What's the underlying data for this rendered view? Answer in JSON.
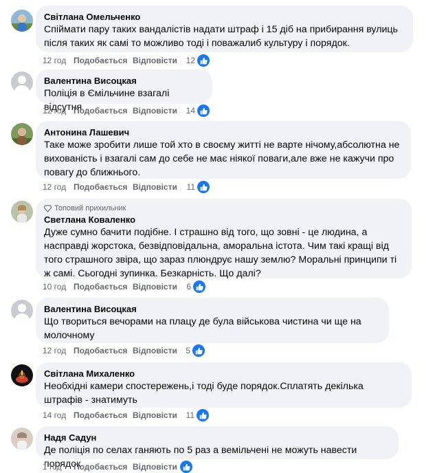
{
  "colors": {
    "bubble_bg": "#f0f2f5",
    "meta_text": "#65676b",
    "like_blue": "#1877f2",
    "text": "#050505"
  },
  "comments": [
    {
      "author": "Світлана Омельченко",
      "badge": "",
      "text": "Спіймати пару таких вандалістів надати штраф і 15 діб на прибирання вулиць після таких як самі то можливо тоді і поважалиб культуру і порядок.",
      "time": "12 год",
      "like_label": "Подобається",
      "reply_label": "Відповісти",
      "reactions": "12",
      "reaction_icon": "thumbs-up-icon",
      "avatar_icon": "profile-photo-icon"
    },
    {
      "author": "Валентина Висоцкая",
      "badge": "",
      "text": "Поліція в Ємільчине взагалі відсутня",
      "time": "12 год",
      "like_label": "Подобається",
      "reply_label": "Відповісти",
      "reactions": "14",
      "reaction_icon": "thumbs-up-icon",
      "avatar_icon": "default-avatar-icon"
    },
    {
      "author": "Антонина Лашевич",
      "badge": "",
      "text": "Таке може зробити лише той хто в своєму житті не варте нічому,абсолютна не вихованість і взагалі сам до себе не має ніякої поваги,але вже не кажучи про повагу до ближнього.",
      "time": "12 год",
      "like_label": "Подобається",
      "reply_label": "Відповісти",
      "reactions": "11",
      "reaction_icon": "thumbs-up-icon",
      "avatar_icon": "profile-photo-icon"
    },
    {
      "author": "Светлана Коваленко",
      "badge": "Топовий прихильник",
      "text": "Дуже сумно бачити подібне. І страшно від того, що зовні - це людина, а насправді жорстока, безвідповідальна, аморальна істота. Чим такі кращі від того страшного звіра, що зараз плюндрує нашу землю? Моральні принципи ті ж самі. Сьогодні зупинка. Безкарність. Що далі?",
      "time": "10 год",
      "like_label": "Подобається",
      "reply_label": "Відповісти",
      "reactions": "6",
      "reaction_icon": "thumbs-up-icon",
      "avatar_icon": "profile-photo-icon"
    },
    {
      "author": "Валентина Висоцкая",
      "badge": "",
      "text": "Що твориться вечорами на плацу де була військова чистина чи ще на молочному",
      "time": "12 год",
      "like_label": "Подобається",
      "reply_label": "Відповісти",
      "reactions": "5",
      "reaction_icon": "thumbs-up-icon",
      "avatar_icon": "default-avatar-icon"
    },
    {
      "author": "Світлана Михаленко",
      "badge": "",
      "text": "Необхідні камери спостережень,і тоді буде порядок.Сплатять декілька штрафів - знатимуть",
      "time": "14 год",
      "like_label": "Подобається",
      "reply_label": "Відповісти",
      "reactions": "11",
      "reaction_icon": "thumbs-up-icon",
      "avatar_icon": "candle-photo-icon"
    },
    {
      "author": "Надя Садун",
      "badge": "",
      "text": "Де поліція по селах ганяють по 5 раз а вемільчені не можуть навести порядок",
      "time": "1 год",
      "like_label": "Подобається",
      "reply_label": "Відповісти",
      "reactions": "",
      "reaction_icon": "thumbs-up-icon",
      "avatar_icon": "profile-photo-icon"
    }
  ]
}
